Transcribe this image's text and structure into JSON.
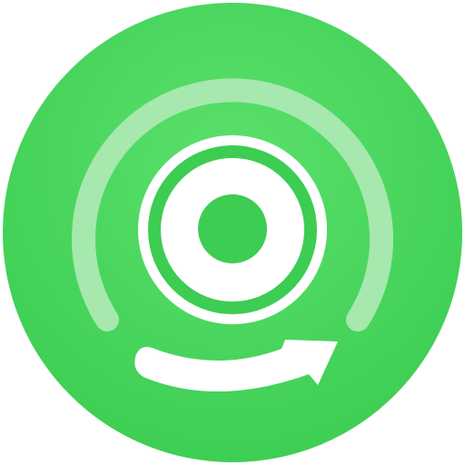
{
  "app_icon": {
    "icon_name": "music-disc-convert-icon",
    "colors": {
      "page_background": "#ffffff",
      "badge_green": "#3ccd52",
      "badge_green_light": "#5ae06c",
      "arc_light_green": "#a6e8ae",
      "disc_white": "#ffffff",
      "hub_green": "#3ccd52",
      "arrow_white": "#ffffff"
    }
  }
}
